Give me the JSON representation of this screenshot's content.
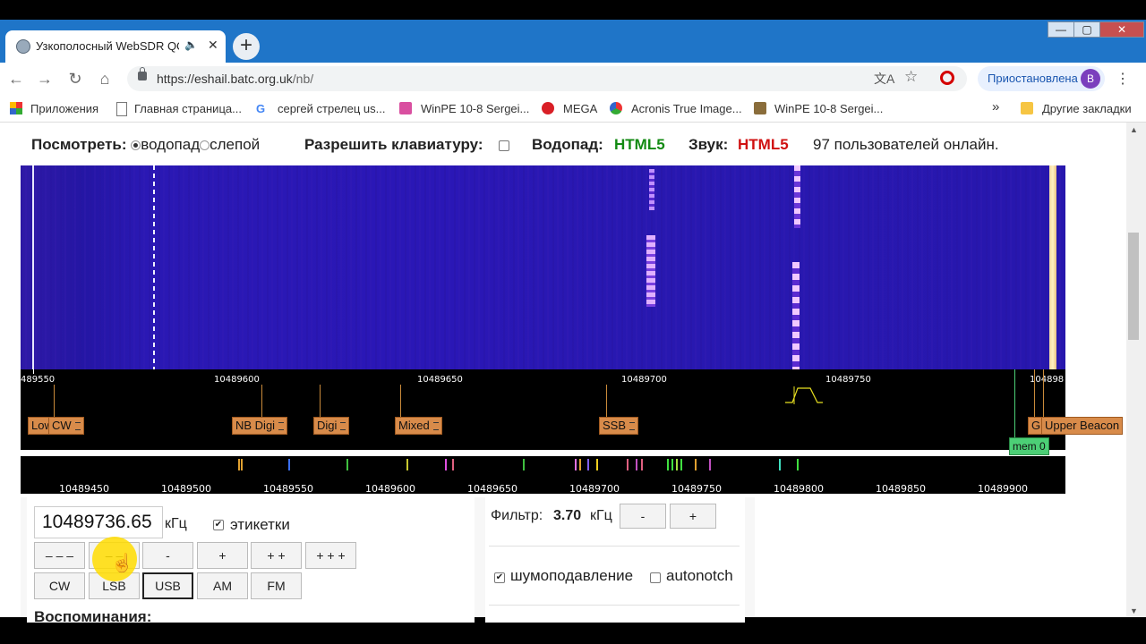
{
  "browser": {
    "tab_title": "Узкополосный WebSDR QO",
    "tab_audio_icon": "speaker-icon",
    "url_host": "https://eshail.batc.org.uk",
    "url_path": "/nb/",
    "profile_label": "Приостановлена",
    "avatar_letter": "B",
    "bookmarks": [
      {
        "label": "Приложения",
        "icon": "apps-grid-icon"
      },
      {
        "label": "Главная страница...",
        "icon": "page-icon"
      },
      {
        "label": "сергей стрелец us...",
        "icon": "google-icon"
      },
      {
        "label": "WinPE 10-8 Sergei...",
        "icon": "winpe-icon"
      },
      {
        "label": "MEGA",
        "icon": "mega-icon"
      },
      {
        "label": "Acronis True Image...",
        "icon": "acronis-icon"
      },
      {
        "label": "WinPE 10-8 Sergei...",
        "icon": "winpe2-icon"
      }
    ],
    "more_bookmarks": "»",
    "other_bookmarks": "Другие закладки"
  },
  "header": {
    "view_label": "Посмотреть:",
    "view_option_waterfall": "водопад",
    "view_option_blind": "слепой",
    "keyboard_label": "Разрешить клавиатуру:",
    "waterfall_label": "Водопад:",
    "waterfall_value": "HTML5",
    "sound_label": "Звук:",
    "sound_value": "HTML5",
    "users_online": "97 пользователей онлайн."
  },
  "scale": {
    "ticks": [
      "489550",
      "10489600",
      "10489650",
      "10489700",
      "10489750",
      "104898"
    ]
  },
  "tags": [
    "Low",
    "CW",
    "NB Digi",
    "Digi",
    "Mixed",
    "SSB",
    "G",
    "Upper Beacon"
  ],
  "memory_tag": "mem 0",
  "overview": {
    "labels": [
      "10489450",
      "10489500",
      "10489550",
      "10489600",
      "10489650",
      "10489700",
      "10489750",
      "10489800",
      "10489850",
      "10489900"
    ]
  },
  "controls": {
    "frequency": "10489736.65",
    "unit": "кГц",
    "labels_checkbox": "этикетки",
    "step_buttons": [
      "– – –",
      "– –",
      "-",
      "+",
      "+ +",
      "+ + +"
    ],
    "mode_buttons": [
      "CW",
      "LSB",
      "USB",
      "AM",
      "FM"
    ],
    "selected_mode": "USB",
    "memories_heading": "Воспоминания:",
    "filter_label": "Фильтр:",
    "filter_value": "3.70",
    "filter_unit": "кГц",
    "filter_minus": "-",
    "filter_plus": "+",
    "noise_reduction": "шумоподавление",
    "autonotch": "autonotch"
  },
  "colors": {
    "html5_waterfall": "#128a12",
    "html5_sound": "#d01010",
    "tag_bg": "#d88b4a",
    "mem_bg": "#4ccf76"
  }
}
